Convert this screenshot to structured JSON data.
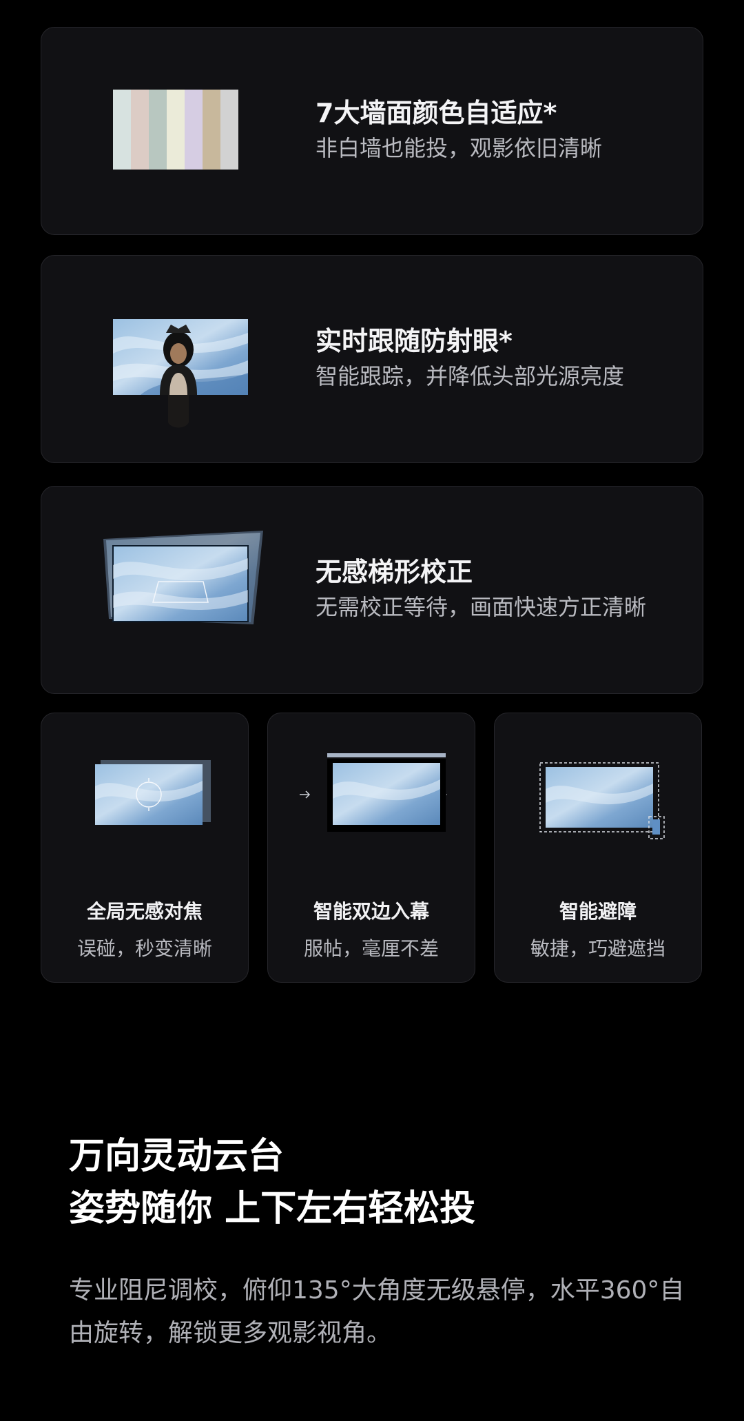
{
  "colors": {
    "background": "#000000",
    "card_bg": "#111114",
    "card_border": "#26262b",
    "title": "#f4f4f6",
    "subtitle": "#b9bac0",
    "wave_light": "#c5dbef",
    "wave_mid": "#8fb5db",
    "wave_dark": "#4f7fb4"
  },
  "wall_colors": [
    "#d7e2e0",
    "#dcccc5",
    "#b8c7c0",
    "#ebebd9",
    "#d6cde3",
    "#c8b89c",
    "#d2d2d2"
  ],
  "feature_cards": [
    {
      "title": "7大墙面颜色自适应*",
      "subtitle": "非白墙也能投，观影依旧清晰",
      "visual": "wall-color-swatches"
    },
    {
      "title": "实时跟随防射眼*",
      "subtitle": "智能跟踪，并降低头部光源亮度",
      "visual": "person-in-front-of-screen"
    },
    {
      "title": "无感梯形校正",
      "subtitle": "无需校正等待，画面快速方正清晰",
      "visual": "keystone-correction-screen"
    }
  ],
  "small_cards": [
    {
      "title": "全局无感对焦",
      "subtitle": "误碰，秒变清晰",
      "visual": "focus-ring-icon"
    },
    {
      "title": "智能双边入幕",
      "subtitle": "服帖，毫厘不差",
      "visual": "screen-align-arrows-icon"
    },
    {
      "title": "智能避障",
      "subtitle": "敏捷，巧避遮挡",
      "visual": "obstacle-avoid-icon"
    }
  ],
  "gimbal_section": {
    "heading_line1": "万向灵动云台",
    "heading_line2": "姿势随你 上下左右轻松投",
    "body": "专业阻尼调校，俯仰135°大角度无级悬停，水平360°自由旋转，解锁更多观影视角。"
  }
}
